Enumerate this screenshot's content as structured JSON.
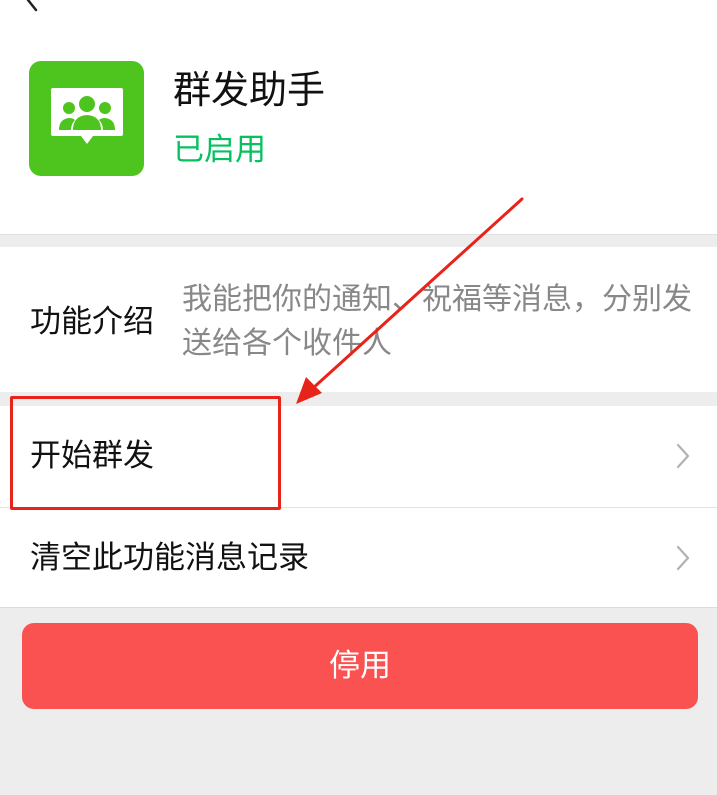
{
  "app": {
    "name": "群发助手",
    "status": "已启用",
    "icon": "group-people-icon",
    "icon_color": "#4dc51e"
  },
  "intro": {
    "label": "功能介绍",
    "text": "我能把你的通知、祝福等消息，分别发送给各个收件人"
  },
  "list": {
    "items": [
      {
        "label": "开始群发"
      },
      {
        "label": "清空此功能消息记录"
      }
    ]
  },
  "button": {
    "disable_label": "停用"
  },
  "colors": {
    "status_green": "#07c160",
    "danger_red": "#fa5151",
    "annotation_red": "#e8231a"
  }
}
